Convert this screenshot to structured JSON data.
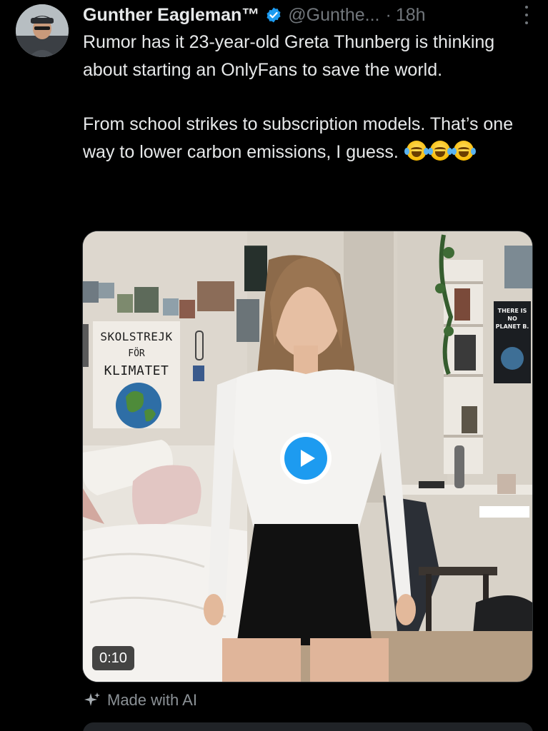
{
  "tweet": {
    "display_name": "Gunther Eagleman™",
    "handle": "@Gunthe...",
    "separator": "·",
    "time": "18h",
    "text_line1": "Rumor has it 23-year-old Greta Thunberg is thinking about starting an OnlyFans to save the world.",
    "text_line2": "From school strikes to subscription models. That’s one way to lower carbon emissions, I guess.",
    "emoji_count": 3
  },
  "media": {
    "sign": {
      "line1": "SKOLSTREJK",
      "line2": "FÖR",
      "line3": "KLIMATET"
    },
    "poster": {
      "line1": "THERE IS",
      "line2": "NO",
      "line3": "PLANET B."
    },
    "duration": "0:10"
  },
  "ai_label": "Made with AI",
  "colors": {
    "background": "#000000",
    "text_primary": "#e7e9ea",
    "text_secondary": "#71767b",
    "accent_blue": "#1d9bf0",
    "verified": "#1d9bf0"
  },
  "icons": {
    "verified": "verified-badge-icon",
    "more": "more-dots-icon",
    "play": "play-icon",
    "ai": "sparkle-icon"
  }
}
